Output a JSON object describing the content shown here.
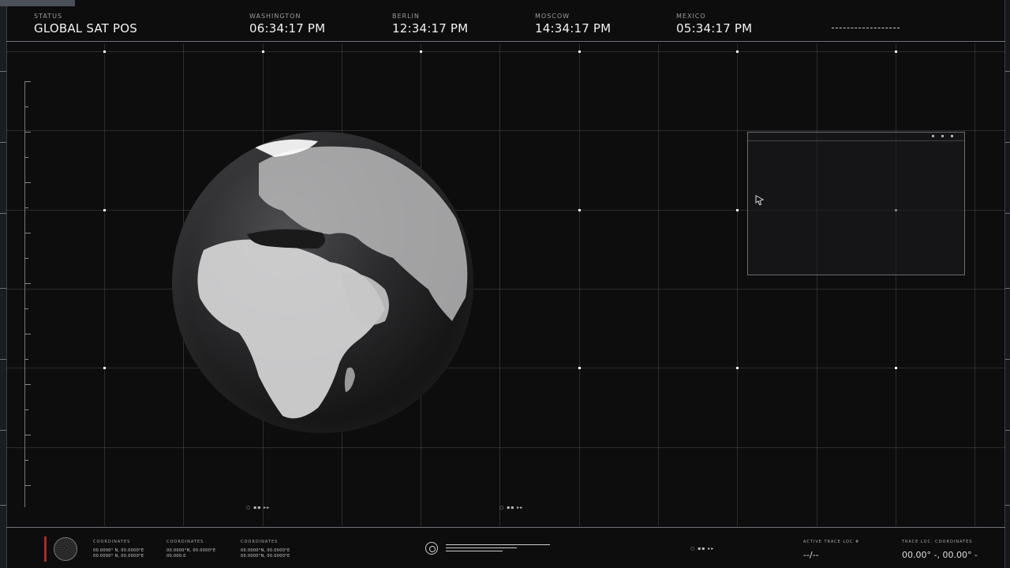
{
  "header": {
    "status_label": "STATUS",
    "status_value": "GLOBAL SAT POS",
    "clocks": [
      {
        "city": "WASHINGTON",
        "time": "06:34:17 PM"
      },
      {
        "city": "BERLIN",
        "time": "12:34:17 PM"
      },
      {
        "city": "MOSCOW",
        "time": "14:34:17 PM"
      },
      {
        "city": "MEXICO",
        "time": "05:34:17 PM"
      }
    ]
  },
  "indicators": {
    "left": "○ ▪▪ ▸▸",
    "center": "○ ▪▪ ▸▸",
    "bottom": "○ ▪▪ ▸▸"
  },
  "footer": {
    "coords": [
      {
        "label": "COORDINATES",
        "line1": "00.0000° N, 00.0000°E",
        "line2": "00.0000° N, 00.0000°E"
      },
      {
        "label": "COORDINATES",
        "line1": "00.0000°N, 00.0000°E",
        "line2": "00.000.0"
      },
      {
        "label": "COORDINATES",
        "line1": "00.0000°N, 00.0000°E",
        "line2": "00.0000°N, 00.0000°E"
      }
    ],
    "active_trace_label": "ACTIVE TRACE LOC #",
    "active_trace_value": "--/--",
    "trace_coords_label": "TRACE LOC. COORDINATES",
    "trace_coords_value": "00.00° -, 00.00° -"
  },
  "colors": {
    "background": "#0d0d0e",
    "grid": "#ffffff",
    "accent_red": "#b02828"
  }
}
